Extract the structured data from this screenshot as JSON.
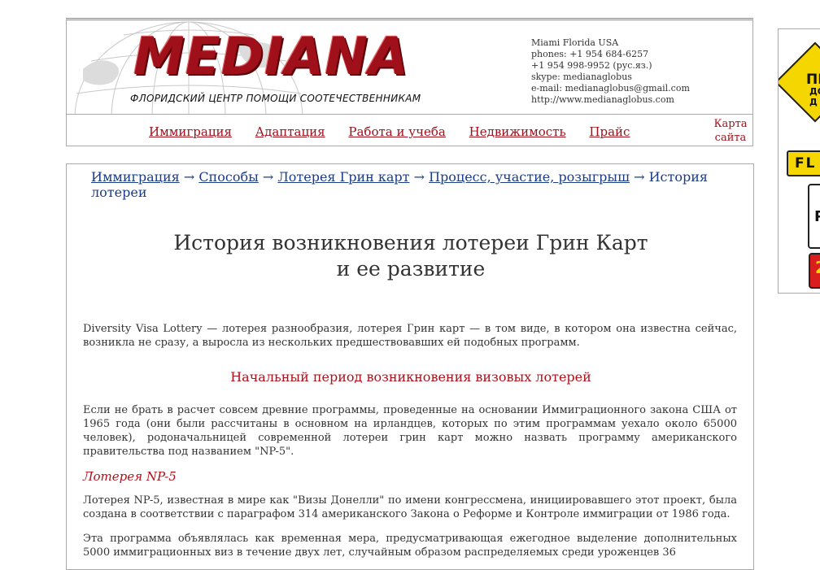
{
  "header": {
    "logo": "MEDIANA",
    "tagline": "ФЛОРИДСКИЙ  ЦЕНТР ПОМОЩИ СООТЕЧЕСТВЕННИКАМ",
    "contacts": [
      "Miami Florida USA",
      "phones: +1 954 684-6257",
      "+1 954 998-9952 (рус.яз.)",
      "skype: medianaglobus",
      "e-mail: medianaglobus@gmail.com",
      "http://www.medianaglobus.com"
    ]
  },
  "nav": {
    "items": [
      "Иммиграция",
      "Адаптация",
      "Работа и учеба",
      "Недвижимость",
      "Прайс"
    ],
    "sitemap": [
      "Карта",
      "сайта"
    ]
  },
  "breadcrumb": {
    "links": [
      "Иммиграция",
      "Способы",
      "Лотерея Грин карт",
      "Процесс, участие, розыгрыш"
    ],
    "separator": "→",
    "current": "История лотереи"
  },
  "content": {
    "title_line1": "История возникновения лотереи Грин Карт",
    "title_line2": "и ее развитие",
    "intro": "Diversity Visa Lottery — лотерея разнообразия, лотерея Грин карт — в том виде, в котором она известна сейчас, возникла не сразу, а выросла из нескольких предшествовавших ей подобных программ.",
    "section_heading": "Начальный период возникновения визовых лотерей",
    "para1": "Если не брать в расчет совсем древние программы, проведенные на основании Иммиграционного закона США от 1965 года (они были рассчитаны в основном на ирландцев, которых по этим программам уехало около 65000 человек), родоначальницей современной лотереи грин карт можно назвать программу американского правительства под названием \"NP-5\".",
    "subsection": "Лотерея NP-5",
    "para2": "Лотерея NP-5, известная в мире как \"Визы Донелли\" по имени конгрессмена, инициировавшего этот проект, была создана в соответствии с параграфом 314 американского Закона о Реформе и Контроле иммиграции от 1986 года.",
    "para3": "Эта программа объявлялась как временная мера, предусматривающая ежегодное выделение дополнительных 5000 иммиграционных виз в течение двух лет, случайным образом распределяемых среди уроженцев 36"
  },
  "banner": {
    "diamond_main": "ПР",
    "diamond_sub1": "ДО",
    "diamond_sub2": "Д",
    "sign_fl": "FL",
    "sign_white": "P",
    "sign_red": "2"
  },
  "colors": {
    "accent_red": "#a0101a",
    "link_blue": "#1a3c86",
    "sign_yellow": "#f6d600"
  }
}
